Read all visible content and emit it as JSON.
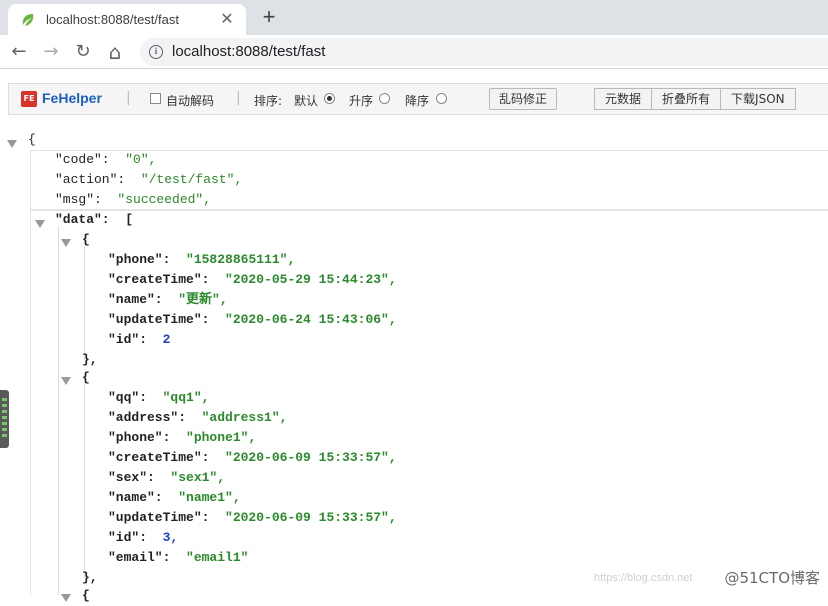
{
  "browser": {
    "tab_title": "localhost:8088/test/fast",
    "close_glyph": "✕",
    "new_tab_glyph": "+",
    "url": "localhost:8088/test/fast",
    "back_glyph": "←",
    "forward_glyph": "→",
    "reload_glyph": "↻",
    "home_glyph": "⌂"
  },
  "fehelper": {
    "brand": "FeHelper",
    "logo_text": "FE",
    "auto_decode_label": "自动解码",
    "sort_label": "排序:",
    "sort_default": "默认",
    "sort_asc": "升序",
    "sort_desc": "降序",
    "fix_garbled_button": "乱码修正",
    "metadata_button": "元数据",
    "fold_all_button": "折叠所有",
    "download_json_button": "下载JSON",
    "sort_selected": "默认"
  },
  "json": {
    "open_brace": "{",
    "code_key": "\"code\":",
    "code_val": "\"0\",",
    "action_key": "\"action\":",
    "action_val": "\"/test/fast\",",
    "msg_key": "\"msg\":",
    "msg_val": "\"succeeded\",",
    "data_key": "\"data\":",
    "data_open": "[",
    "items": [
      {
        "open": "{",
        "lines": [
          {
            "key": "\"phone\":",
            "val": "\"15828865111\",",
            "type": "s"
          },
          {
            "key": "\"createTime\":",
            "val": "\"2020-05-29 15:44:23\",",
            "type": "s"
          },
          {
            "key": "\"name\":",
            "val": "\"更新\",",
            "type": "s"
          },
          {
            "key": "\"updateTime\":",
            "val": "\"2020-06-24 15:43:06\",",
            "type": "s"
          },
          {
            "key": "\"id\":",
            "val": "2",
            "type": "n"
          }
        ],
        "close": "},"
      },
      {
        "open": "{",
        "lines": [
          {
            "key": "\"qq\":",
            "val": "\"qq1\",",
            "type": "s"
          },
          {
            "key": "\"address\":",
            "val": "\"address1\",",
            "type": "s"
          },
          {
            "key": "\"phone\":",
            "val": "\"phone1\",",
            "type": "s"
          },
          {
            "key": "\"createTime\":",
            "val": "\"2020-06-09 15:33:57\",",
            "type": "s"
          },
          {
            "key": "\"sex\":",
            "val": "\"sex1\",",
            "type": "s"
          },
          {
            "key": "\"name\":",
            "val": "\"name1\",",
            "type": "s"
          },
          {
            "key": "\"updateTime\":",
            "val": "\"2020-06-09 15:33:57\",",
            "type": "s"
          },
          {
            "key": "\"id\":",
            "val": "3,",
            "type": "n"
          },
          {
            "key": "\"email\":",
            "val": "\"email1\"",
            "type": "s"
          }
        ],
        "close": "},"
      }
    ],
    "next_open": "{"
  },
  "watermark": "@51CTO博客",
  "watermark_faint": "https://blog.csdn.net",
  "colors": {
    "string": "#2b8a2b",
    "number": "#1e3fbf",
    "brand": "#1d5fbf"
  }
}
